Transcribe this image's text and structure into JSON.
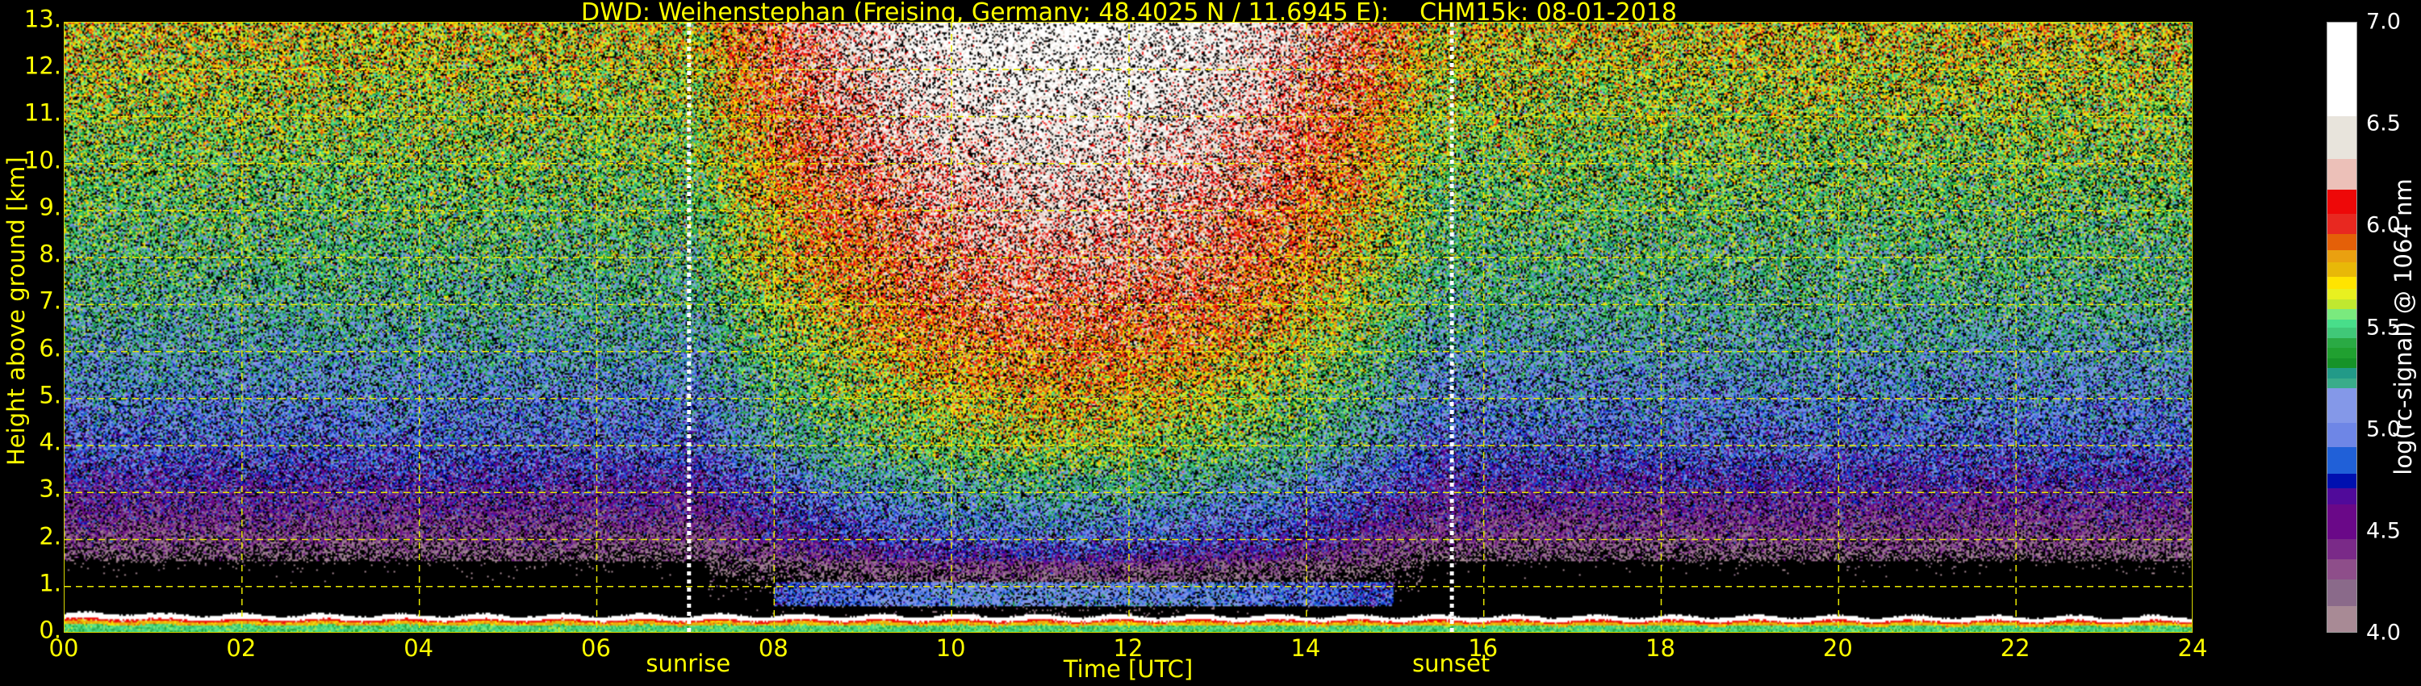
{
  "chart_data": {
    "type": "heatmap",
    "title": "DWD: Weihenstephan (Freising, Germany; 48.4025 N / 11.6945 E):    CHM15k: 08-01-2018",
    "xlabel": "Time [UTC]",
    "ylabel": "Height above ground [km]",
    "xlim": [
      0,
      24
    ],
    "ylim": [
      0,
      13
    ],
    "grid": true,
    "xticks": [
      0,
      2,
      4,
      6,
      8,
      10,
      12,
      14,
      16,
      18,
      20,
      22,
      24
    ],
    "xtick_labels": [
      "00",
      "02",
      "04",
      "06",
      "08",
      "10",
      "12",
      "14",
      "16",
      "18",
      "20",
      "22",
      "24"
    ],
    "yticks": [
      0,
      1,
      2,
      3,
      4,
      5,
      6,
      7,
      8,
      9,
      10,
      11,
      12,
      13
    ],
    "ytick_labels": [
      "0.",
      "1.",
      "2.",
      "3.",
      "4.",
      "5.",
      "6.",
      "7.",
      "8.",
      "9.",
      "10.",
      "11.",
      "12.",
      "13."
    ],
    "annotations": [
      {
        "label": "sunrise",
        "x": 7.04
      },
      {
        "label": "sunset",
        "x": 15.64
      }
    ],
    "colorbar": {
      "label": "log(rc-signal) @ 1064 nm",
      "range": [
        4.0,
        7.0
      ],
      "ticks": [
        4.0,
        4.5,
        5.0,
        5.5,
        6.0,
        6.5,
        7.0
      ],
      "tick_labels": [
        "4.0",
        "4.5",
        "5.0",
        "5.5",
        "6.0",
        "6.5",
        "7.0"
      ],
      "levels": [
        {
          "from": 4.0,
          "to": 4.13,
          "color": "#a88a95"
        },
        {
          "from": 4.13,
          "to": 4.26,
          "color": "#8a6a8a"
        },
        {
          "from": 4.26,
          "to": 4.36,
          "color": "#8e4e8a"
        },
        {
          "from": 4.36,
          "to": 4.46,
          "color": "#7a2a88"
        },
        {
          "from": 4.46,
          "to": 4.63,
          "color": "#6a0888"
        },
        {
          "from": 4.63,
          "to": 4.71,
          "color": "#500a9a"
        },
        {
          "from": 4.71,
          "to": 4.78,
          "color": "#0010b0"
        },
        {
          "from": 4.78,
          "to": 4.91,
          "color": "#2060d8"
        },
        {
          "from": 4.91,
          "to": 5.03,
          "color": "#6e86e6"
        },
        {
          "from": 5.03,
          "to": 5.2,
          "color": "#8498e8"
        },
        {
          "from": 5.2,
          "to": 5.25,
          "color": "#3aac8a"
        },
        {
          "from": 5.25,
          "to": 5.3,
          "color": "#229a88"
        },
        {
          "from": 5.3,
          "to": 5.35,
          "color": "#169328"
        },
        {
          "from": 5.35,
          "to": 5.4,
          "color": "#20a030"
        },
        {
          "from": 5.4,
          "to": 5.45,
          "color": "#2aaa44"
        },
        {
          "from": 5.45,
          "to": 5.5,
          "color": "#40c878"
        },
        {
          "from": 5.5,
          "to": 5.54,
          "color": "#48de8a"
        },
        {
          "from": 5.54,
          "to": 5.59,
          "color": "#7aea7e"
        },
        {
          "from": 5.59,
          "to": 5.64,
          "color": "#c0e830"
        },
        {
          "from": 5.64,
          "to": 5.69,
          "color": "#e8f020"
        },
        {
          "from": 5.69,
          "to": 5.75,
          "color": "#ffe400"
        },
        {
          "from": 5.75,
          "to": 5.82,
          "color": "#e8b808"
        },
        {
          "from": 5.82,
          "to": 5.88,
          "color": "#eaa010"
        },
        {
          "from": 5.88,
          "to": 5.96,
          "color": "#e46008"
        },
        {
          "from": 5.96,
          "to": 6.06,
          "color": "#e82820"
        },
        {
          "from": 6.06,
          "to": 6.18,
          "color": "#ee0808"
        },
        {
          "from": 6.18,
          "to": 6.33,
          "color": "#ecc0b8"
        },
        {
          "from": 6.33,
          "to": 6.54,
          "color": "#e8e4dc"
        },
        {
          "from": 6.54,
          "to": 7.0,
          "color": "#ffffff"
        }
      ]
    },
    "features": {
      "boundary_layer_top_km": 0.35,
      "daytime_aerosol_layer_km": [
        0.6,
        1.0
      ]
    }
  }
}
